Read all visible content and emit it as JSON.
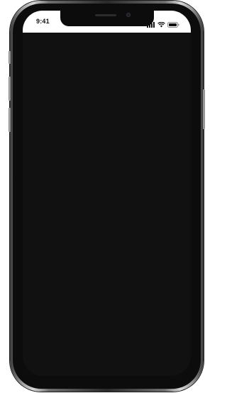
{
  "status_bar": {
    "time": "9:41",
    "icons": [
      "signal-icon",
      "wifi-icon",
      "battery-icon"
    ]
  },
  "colors": {
    "screen_background": "#111111",
    "status_bar_background": "#ffffff",
    "frame": "#2a2a2a"
  }
}
